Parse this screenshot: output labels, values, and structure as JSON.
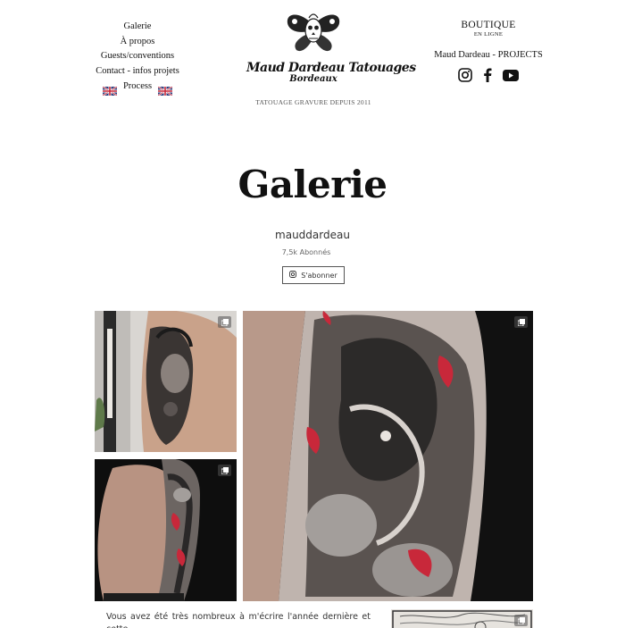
{
  "nav": {
    "left": [
      "Galerie",
      "À propos",
      "Guests/conventions",
      "Contact - infos projets"
    ],
    "process": "Process"
  },
  "logo": {
    "brand": "Maud Dardeau Tatouages",
    "city": "Bordeaux",
    "since": "TATOUAGE GRAVURE DEPUIS 2011"
  },
  "right": {
    "boutique": "BOUTIQUE",
    "en_ligne": "EN LIGNE",
    "projects": "Maud Dardeau - PROJECTS",
    "socials": [
      "instagram-icon",
      "facebook-icon",
      "youtube-icon"
    ]
  },
  "gallery": {
    "title": "Galerie",
    "account": "mauddardeau",
    "followers": "7,5k Abonnés",
    "subscribe": "S'abonner"
  },
  "text": {
    "intro": "Vous avez été très nombreux à m'écrire l'année dernière et cette"
  },
  "colors": {
    "text": "#111111",
    "muted": "#666666",
    "accent_red": "#c8283a"
  }
}
